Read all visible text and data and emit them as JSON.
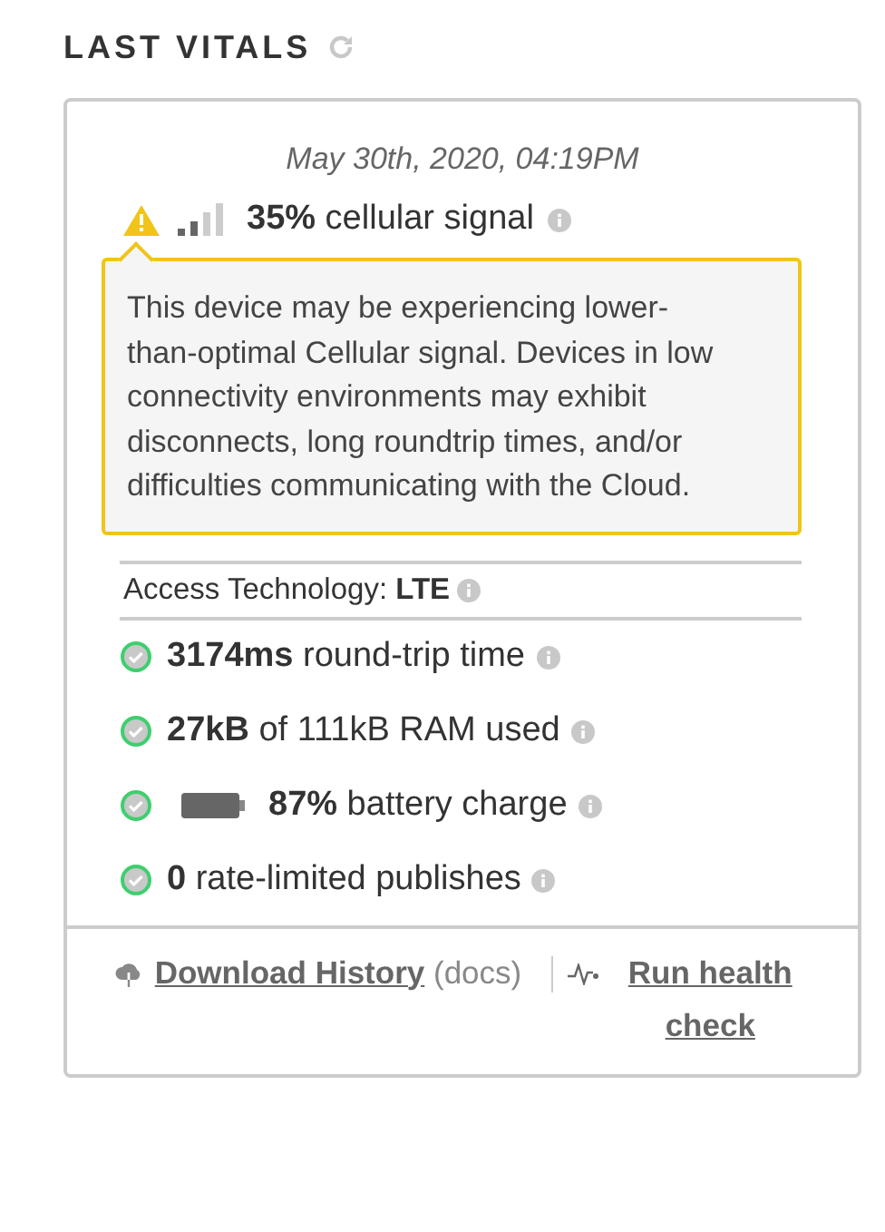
{
  "header": {
    "title": "LAST VITALS"
  },
  "timestamp": "May 30th, 2020, 04:19PM",
  "signal": {
    "warning": true,
    "value": "35%",
    "label": "cellular signal"
  },
  "warning_popover": {
    "text": "This device may be experiencing lower-than-optimal Cellular signal. Devices in low connectivity environments may exhibit disconnects, long roundtrip times, and/or difficulties communicating with the Cloud."
  },
  "access_technology": {
    "label": "Access Technology:",
    "value": "LTE"
  },
  "vitals": [
    {
      "ok": true,
      "kind": "text",
      "value": "3174ms",
      "label": "round-trip time"
    },
    {
      "ok": true,
      "kind": "text",
      "value": "27kB",
      "label": "of 111kB RAM used"
    },
    {
      "ok": true,
      "kind": "battery",
      "value": "87%",
      "label": "battery charge"
    },
    {
      "ok": true,
      "kind": "text",
      "value": "0",
      "label": "rate-limited publishes"
    }
  ],
  "footer": {
    "download_link": "Download History",
    "docs_open": "(",
    "docs_link": "docs",
    "docs_close": ")",
    "health_link": "Run health check"
  }
}
